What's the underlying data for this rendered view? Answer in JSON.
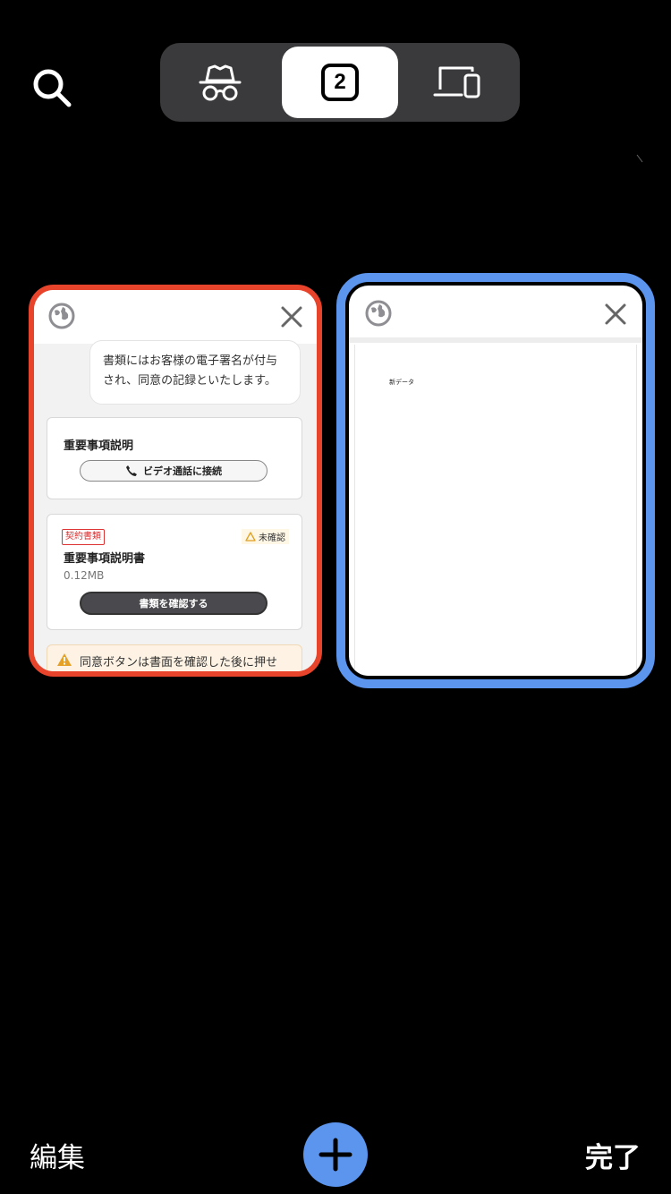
{
  "toolbar": {
    "tab_count": "2",
    "segments": [
      "incognito-tabs",
      "open-tabs",
      "other-devices"
    ]
  },
  "tabs": [
    {
      "bubble_text_line1": "書類にはお客様の電子署名が付与",
      "bubble_text_line2": "され、同意の記録といたします。",
      "section1_title": "重要事項説明",
      "video_call_label": "ビデオ通話に接続",
      "doc_tag": "契約書類",
      "doc_status": "未確認",
      "doc_title": "重要事項説明書",
      "doc_size": "0.12MB",
      "doc_button": "書類を確認する",
      "warning_text": "同意ボタンは書面を確認した後に押せ"
    },
    {
      "page_text": "新データ"
    }
  ],
  "bottom_bar": {
    "edit_label": "編集",
    "done_label": "完了"
  },
  "colors": {
    "active_tab_border": "#5b95ee",
    "recorded_tab_border": "#e8432b",
    "new_tab_button": "#5b95ee"
  }
}
